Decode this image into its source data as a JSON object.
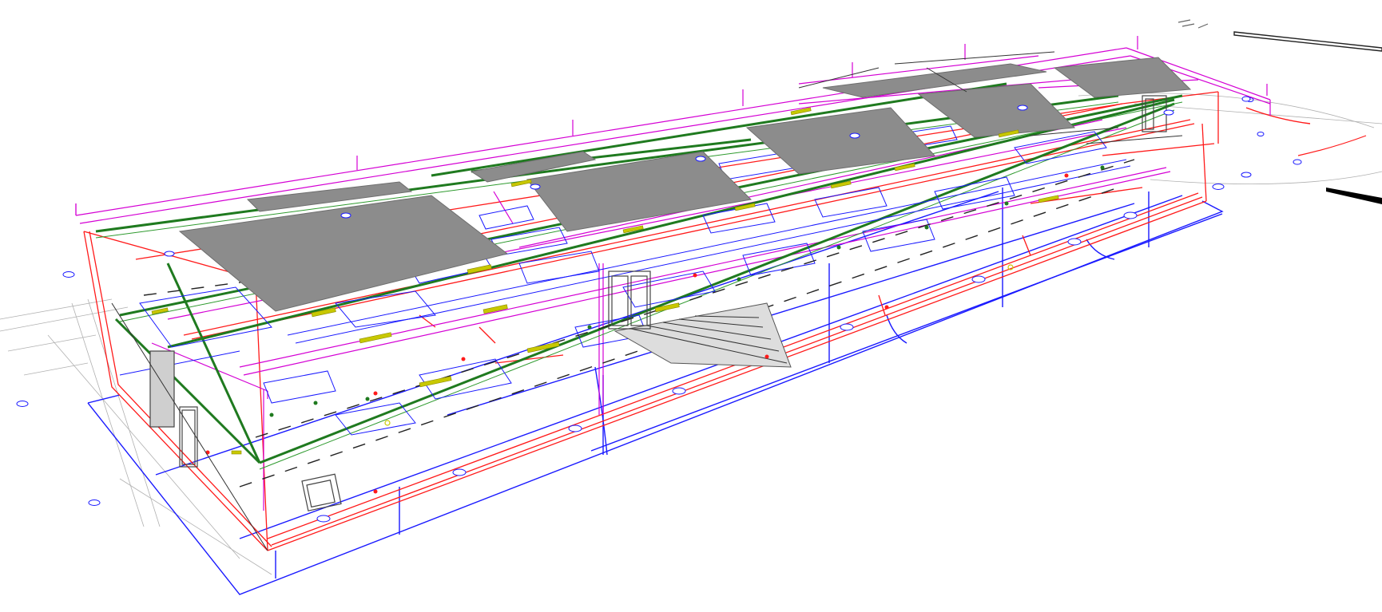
{
  "view": {
    "type": "3d-isometric-bim-model"
  },
  "colors": {
    "background": "#ffffff",
    "roof_panel": "#8c8c8c",
    "roof_panel_edge": "#6e6e6e",
    "structure_red": "#ff1a1a",
    "grid_blue": "#1a1aff",
    "utility_magenta": "#d400d4",
    "cable_tray_green": "#1f7a1f",
    "fixture_yellow": "#c8c800",
    "grey_lines": "#9a9a9a",
    "dark_lines": "#333333"
  },
  "layers": [
    {
      "name": "roof-panels",
      "color_key": "roof_panel"
    },
    {
      "name": "structural-frame",
      "color_key": "structure_red"
    },
    {
      "name": "gridlines",
      "color_key": "grid_blue"
    },
    {
      "name": "piping",
      "color_key": "utility_magenta"
    },
    {
      "name": "cable-trays",
      "color_key": "cable_tray_green"
    },
    {
      "name": "light-fixtures",
      "color_key": "fixture_yellow"
    }
  ]
}
